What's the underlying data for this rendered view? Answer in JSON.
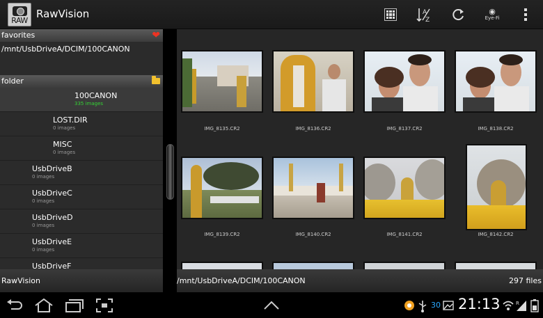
{
  "app": {
    "title": "RawVision",
    "icon_label": "RAW"
  },
  "toolbar": {
    "icons": [
      "grid-view-icon",
      "sort-icon",
      "refresh-icon",
      "eye-fi-icon",
      "overflow-menu-icon"
    ],
    "sort_label": "A Z",
    "eyefi_label": "Eye-Fi"
  },
  "sidebar": {
    "favorites_header": "favorites",
    "favorites": [
      "/mnt/UsbDriveA/DCIM/100CANON"
    ],
    "folder_header": "folder",
    "folders": [
      {
        "name": "100CANON",
        "count": "335 images",
        "selected": true
      },
      {
        "name": "LOST.DIR",
        "count": "0 images"
      },
      {
        "name": "MISC",
        "count": "0 images"
      },
      {
        "name": "UsbDriveB",
        "count": "0 images"
      },
      {
        "name": "UsbDriveC",
        "count": "0 images"
      },
      {
        "name": "UsbDriveD",
        "count": "0 images"
      },
      {
        "name": "UsbDriveE",
        "count": "0 images"
      },
      {
        "name": "UsbDriveF",
        "count": ""
      }
    ],
    "footer": "RawVision"
  },
  "gallery": {
    "items": [
      {
        "filename": "IMG_8135.CR2"
      },
      {
        "filename": "IMG_8136.CR2"
      },
      {
        "filename": "IMG_8137.CR2"
      },
      {
        "filename": "IMG_8138.CR2"
      },
      {
        "filename": "IMG_8139.CR2"
      },
      {
        "filename": "IMG_8140.CR2"
      },
      {
        "filename": "IMG_8141.CR2"
      },
      {
        "filename": "IMG_8142.CR2"
      }
    ],
    "path": "/mnt/UsbDriveA/DCIM/100CANON",
    "file_count": "297 files"
  },
  "system_bar": {
    "time": "21:13",
    "battery_number": "30",
    "colors": {
      "accent": "#2aa8ff",
      "selected_count": "#35d335"
    }
  }
}
